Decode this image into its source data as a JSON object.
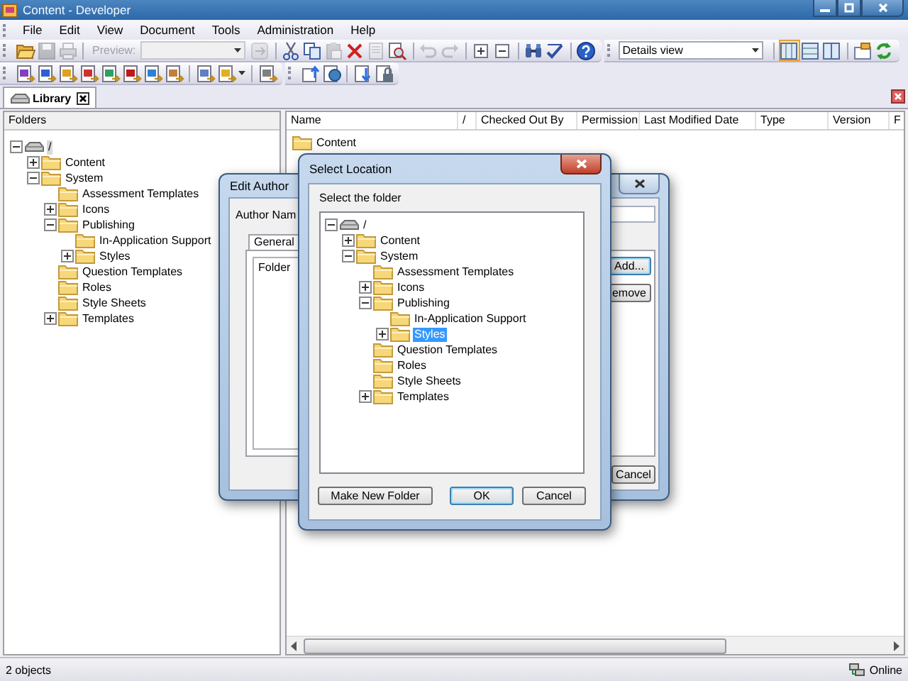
{
  "window": {
    "title": "Content - Developer"
  },
  "menu": [
    "File",
    "Edit",
    "View",
    "Document",
    "Tools",
    "Administration",
    "Help"
  ],
  "toolbar_1": {
    "items": [
      {
        "kind": "open",
        "disabled": false
      },
      {
        "kind": "save",
        "disabled": true
      },
      {
        "kind": "print",
        "disabled": true
      },
      {
        "kind": "separator"
      },
      {
        "kind": "label",
        "text": "Preview:",
        "disabled": true
      },
      {
        "kind": "combo",
        "disabled": true
      },
      {
        "kind": "go",
        "disabled": true
      },
      {
        "kind": "separator"
      },
      {
        "kind": "cut",
        "disabled": false
      },
      {
        "kind": "copy",
        "disabled": false
      },
      {
        "kind": "paste",
        "disabled": true
      },
      {
        "kind": "delete",
        "disabled": false
      },
      {
        "kind": "properties",
        "disabled": true
      },
      {
        "kind": "preview",
        "disabled": false
      },
      {
        "kind": "separator"
      },
      {
        "kind": "undo",
        "disabled": true
      },
      {
        "kind": "redo",
        "disabled": true
      },
      {
        "kind": "separator"
      },
      {
        "kind": "expand",
        "disabled": false
      },
      {
        "kind": "collapse",
        "disabled": false
      },
      {
        "kind": "separator"
      },
      {
        "kind": "find",
        "disabled": false
      },
      {
        "kind": "spell",
        "disabled": false
      },
      {
        "kind": "separator"
      },
      {
        "kind": "help",
        "disabled": false
      }
    ],
    "view_select": "Details view",
    "view_buttons": [
      {
        "kind": "details",
        "selected": true
      },
      {
        "kind": "rows",
        "selected": false
      },
      {
        "kind": "columns",
        "selected": false
      }
    ],
    "extra": [
      {
        "kind": "folder-window"
      },
      {
        "kind": "refresh"
      }
    ]
  },
  "toolbar_2": {
    "groups": [
      [
        {
          "kind": "purple"
        },
        {
          "kind": "blue"
        },
        {
          "kind": "gold"
        },
        {
          "kind": "red"
        },
        {
          "kind": "green"
        },
        {
          "kind": "crimson"
        },
        {
          "kind": "sky"
        },
        {
          "kind": "brown"
        },
        {
          "kind": "separator"
        },
        {
          "kind": "slate"
        },
        {
          "kind": "menu"
        },
        {
          "kind": "separator"
        },
        {
          "kind": "grey"
        }
      ],
      [
        {
          "kind": "up"
        },
        {
          "kind": "web"
        },
        {
          "kind": "separator"
        },
        {
          "kind": "down"
        },
        {
          "kind": "lock"
        }
      ]
    ]
  },
  "tabs": [
    {
      "label": "Library",
      "selected": true
    }
  ],
  "folders_pane": {
    "title": "Folders",
    "tree": [
      {
        "label": "/",
        "kind": "drive",
        "expanded": true,
        "selected": true,
        "children": [
          {
            "label": "Content",
            "kind": "folder",
            "expanded": false,
            "selected": false
          },
          {
            "label": "System",
            "kind": "folder",
            "expanded": true,
            "selected": false,
            "children": [
              {
                "label": "Assessment Templates",
                "kind": "folder",
                "selected": false
              },
              {
                "label": "Icons",
                "kind": "folder",
                "expanded": false,
                "selected": false
              },
              {
                "label": "Publishing",
                "kind": "folder",
                "expanded": true,
                "selected": false,
                "children": [
                  {
                    "label": "In-Application Support",
                    "kind": "folder",
                    "selected": false
                  },
                  {
                    "label": "Styles",
                    "kind": "folder",
                    "expanded": false,
                    "selected": false
                  }
                ]
              },
              {
                "label": "Question Templates",
                "kind": "folder",
                "selected": false
              },
              {
                "label": "Roles",
                "kind": "folder",
                "selected": false
              },
              {
                "label": "Style Sheets",
                "kind": "folder",
                "selected": false
              },
              {
                "label": "Templates",
                "kind": "folder",
                "expanded": false,
                "selected": false
              }
            ]
          }
        ]
      }
    ]
  },
  "list": {
    "columns": [
      "Name",
      "/",
      "Checked Out By",
      "Permission",
      "Last Modified Date",
      "Type",
      "Version",
      "F"
    ],
    "rows": [
      {
        "name": "Content"
      }
    ]
  },
  "status_bar": {
    "count": "2 objects",
    "connection": "Online"
  },
  "edit_author_dialog": {
    "title": "Edit Author",
    "author_label": "Author Nam",
    "tabs": [
      {
        "label": "General",
        "selected": true
      }
    ],
    "folder_column": "Folder",
    "buttons": [
      {
        "kind": "side",
        "label": "Add...",
        "default": true
      },
      {
        "kind": "side",
        "label": "emove",
        "default": false
      },
      {
        "kind": "bottom",
        "label": "Cancel",
        "default": false
      }
    ]
  },
  "select_location_dialog": {
    "title": "Select Location",
    "prompt": "Select the folder",
    "tree": [
      {
        "label": "/",
        "kind": "drive",
        "expanded": true,
        "selected": false,
        "children": [
          {
            "label": "Content",
            "kind": "folder",
            "expanded": false,
            "selected": false
          },
          {
            "label": "System",
            "kind": "folder",
            "expanded": true,
            "selected": false,
            "children": [
              {
                "label": "Assessment Templates",
                "kind": "folder",
                "selected": false
              },
              {
                "label": "Icons",
                "kind": "folder",
                "expanded": false,
                "selected": false
              },
              {
                "label": "Publishing",
                "kind": "folder",
                "expanded": true,
                "selected": false,
                "children": [
                  {
                    "label": "In-Application Support",
                    "kind": "folder",
                    "selected": false
                  },
                  {
                    "label": "Styles",
                    "kind": "folder",
                    "expanded": false,
                    "selected": true
                  }
                ]
              },
              {
                "label": "Question Templates",
                "kind": "folder",
                "selected": false
              },
              {
                "label": "Roles",
                "kind": "folder",
                "selected": false
              },
              {
                "label": "Style Sheets",
                "kind": "folder",
                "selected": false
              },
              {
                "label": "Templates",
                "kind": "folder",
                "expanded": false,
                "selected": false
              }
            ]
          }
        ]
      }
    ],
    "buttons": [
      {
        "label": "Make New Folder",
        "default": false
      },
      {
        "label": "OK",
        "default": true
      },
      {
        "label": "Cancel",
        "default": false
      }
    ]
  }
}
